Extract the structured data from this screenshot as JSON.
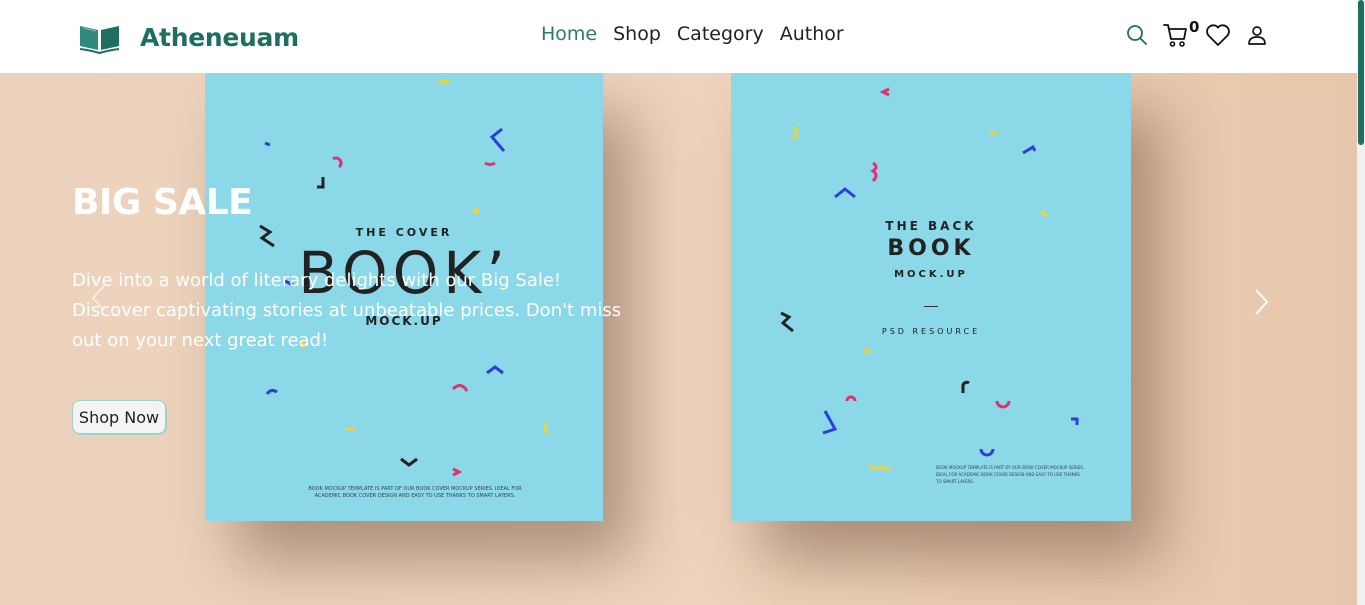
{
  "brand": {
    "name": "Atheneuam",
    "logo_icon": "open-book-icon"
  },
  "nav": {
    "links": [
      "Home",
      "Shop",
      "Category",
      "Author"
    ],
    "active": "Home",
    "cart_count": "0",
    "icons": [
      "search-icon",
      "cart-icon",
      "heart-icon",
      "user-icon"
    ]
  },
  "hero": {
    "title": "BIG SALE",
    "description": "Dive into a world of literary delights with our Big Sale! Discover captivating stories at unbeatable prices. Don't miss out on your next great read!",
    "button_label": "Shop Now",
    "prev_icon": "chevron-left-icon",
    "next_icon": "chevron-right-icon"
  },
  "hero_image": {
    "front_cover": {
      "small": "THE COVER",
      "big": "BOOK’",
      "mock": "MOCK.UP",
      "fine": "BOOK MOCKUP TEMPLATE IS PART OF OUR BOOK COVER MOCKUP SERIES. IDEAL FOR ACADEMIC BOOK COVER DESIGN AND EASY TO USE THANKS TO SMART LAYERS."
    },
    "back_cover": {
      "small": "THE BACK",
      "big": "BOOK",
      "mock": "MOCK.UP",
      "psd": "PSD RESOURCE",
      "fine": "BOOK MOCKUP TEMPLATE IS PART OF OUR BOOK COVER MOCKUP SERIES. IDEAL FOR ACADEMIC BOOK COVER DESIGN AND EASY TO USE THANKS TO SMART LAYERS."
    }
  },
  "colors": {
    "brand": "#1f6e62",
    "active_link": "#2c7a6c",
    "book": "#8bd9e8",
    "background": "#ecd2bb"
  }
}
